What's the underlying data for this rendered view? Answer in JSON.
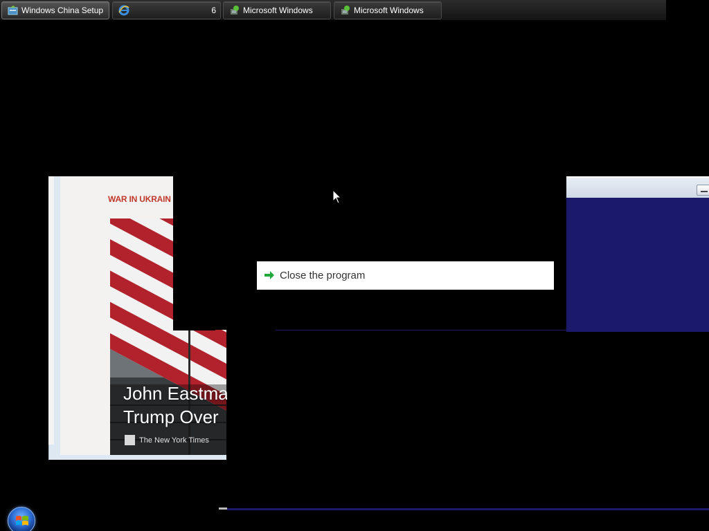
{
  "taskbar": {
    "items": [
      {
        "label": "Windows China Setup",
        "icon": "setup-icon",
        "active": true
      },
      {
        "label": "",
        "icon": "internet-explorer-icon",
        "count": "6",
        "active": false
      },
      {
        "label": "Microsoft Windows",
        "icon": "windows-installer-icon",
        "active": false
      },
      {
        "label": "Microsoft Windows",
        "icon": "windows-installer-icon",
        "active": false
      }
    ]
  },
  "news_card": {
    "category": "WAR IN UKRAIN",
    "headline_line1": "John Eastma",
    "headline_line2": "Trump Over",
    "source": "The New York Times"
  },
  "dialog": {
    "option_label": "Close the program",
    "option_icon": "green-arrow-icon"
  },
  "colors": {
    "desktop": "#000000",
    "category_red": "#c0392b",
    "blue_window": "#1b1a6a",
    "arrow_green": "#22a83a"
  },
  "start_button": {
    "icon": "windows-start-orb-icon"
  }
}
